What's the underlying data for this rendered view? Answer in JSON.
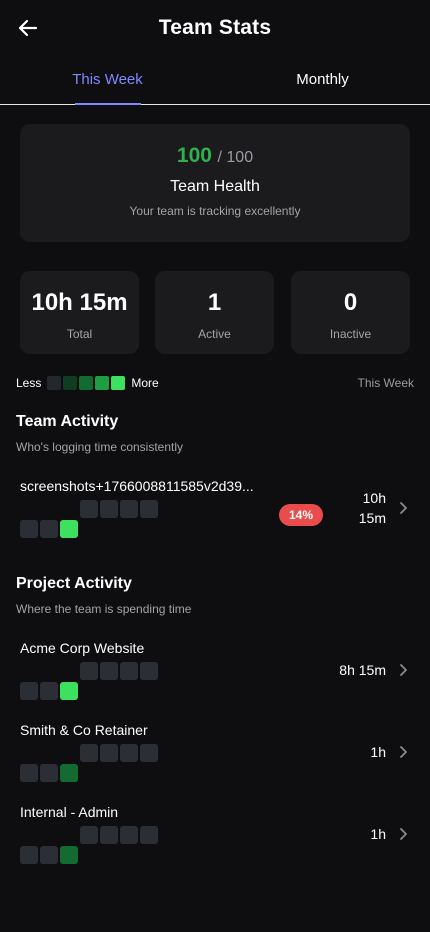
{
  "header": {
    "title": "Team Stats",
    "back_icon": "arrow-left-icon"
  },
  "tabs": [
    {
      "label": "This Week",
      "active": true
    },
    {
      "label": "Monthly",
      "active": false
    }
  ],
  "health": {
    "score": "100",
    "max": "/ 100",
    "title": "Team Health",
    "subtitle": "Your team is tracking excellently"
  },
  "stats": [
    {
      "value": "10h 15m",
      "label": "Total"
    },
    {
      "value": "1",
      "label": "Active"
    },
    {
      "value": "0",
      "label": "Inactive"
    }
  ],
  "legend": {
    "less": "Less",
    "more": "More",
    "period": "This Week",
    "colors": [
      "#24282c",
      "#0f3d22",
      "#136b32",
      "#1e9d43",
      "#3ee05f"
    ]
  },
  "team_activity": {
    "title": "Team Activity",
    "subtitle": "Who's logging time consistently",
    "rows": [
      {
        "name": "screenshots+1766008811585v2d39...",
        "badge": "14%",
        "time_line1": "10h",
        "time_line2": "15m",
        "levels": [
          0,
          0,
          0,
          0,
          0,
          0,
          4
        ]
      }
    ]
  },
  "project_activity": {
    "title": "Project Activity",
    "subtitle": "Where the team is spending time",
    "rows": [
      {
        "name": "Acme Corp Website",
        "time": "8h 15m",
        "levels": [
          0,
          0,
          0,
          0,
          0,
          0,
          4
        ]
      },
      {
        "name": "Smith & Co Retainer",
        "time": "1h",
        "levels": [
          0,
          0,
          0,
          0,
          0,
          0,
          2
        ]
      },
      {
        "name": "Internal - Admin",
        "time": "1h",
        "levels": [
          0,
          0,
          0,
          0,
          0,
          0,
          2
        ]
      }
    ]
  },
  "colors": {
    "accent": "#7f89ff",
    "health_green": "#30b14b",
    "badge_red": "#ea4c4c",
    "card_bg": "#1b1b1e"
  }
}
